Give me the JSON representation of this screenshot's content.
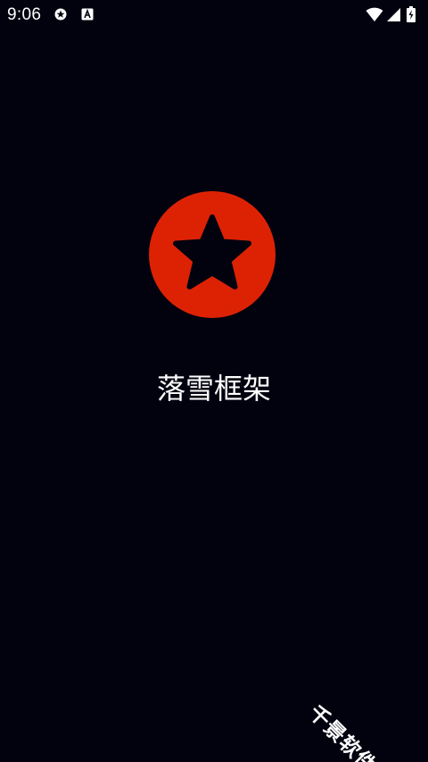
{
  "status_bar": {
    "time": "9:06",
    "left_icons": [
      "settings-badge-icon",
      "text-a-icon"
    ],
    "right_icons": [
      "wifi-icon",
      "cellular-signal-icon",
      "battery-charging-icon"
    ]
  },
  "app": {
    "icon": "star-icon",
    "icon_color": "#dd2204",
    "name": "落雪框架"
  },
  "watermark": {
    "text": "千景软件站"
  },
  "colors": {
    "background": "#02020f",
    "text": "#ffffff"
  }
}
